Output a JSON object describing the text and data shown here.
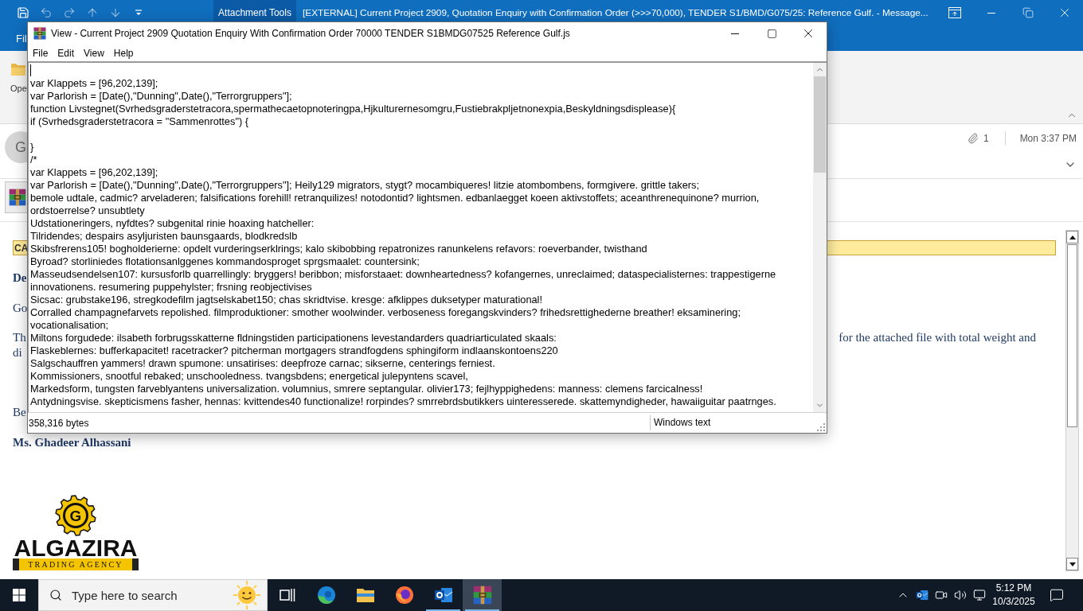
{
  "outlook": {
    "contextual_tab": "Attachment Tools",
    "title": "[EXTERNAL] Current Project 2909, Quotation Enquiry with Confirmation Order (>>>70,000), TENDER S1/BMD/G075/25: Reference Gulf. - Message...",
    "ribbon_tab": "Fil",
    "ribbon_button": "Ope",
    "sender_initials": "G",
    "attachment_count": "1",
    "received": "Mon 3:37 PM",
    "banner": "CA",
    "body": [
      {
        "kind": "heading",
        "text": "De"
      },
      {
        "kind": "text",
        "text": "Go"
      },
      {
        "kind": "split",
        "left": "Th",
        "right": "for the attached file with total weight and"
      },
      {
        "kind": "continuation",
        "text": "di"
      },
      {
        "kind": "closing",
        "text": "Be"
      },
      {
        "kind": "signature",
        "text": "Ms. Ghadeer Alhassani"
      }
    ],
    "logo": {
      "emblem": "G",
      "name": "ALGAZIRA",
      "tagline": "TRADING AGENCY"
    }
  },
  "viewer": {
    "title": "View - Current Project 2909 Quotation Enquiry With Confirmation Order 70000 TENDER S1BMDG07525 Reference Gulf.js",
    "menu": [
      "File",
      "Edit",
      "View",
      "Help"
    ],
    "lines": [
      {
        "kind": "cursor"
      },
      {
        "kind": "text",
        "text": "var Klappets = [96,202,139];"
      },
      {
        "kind": "text",
        "text": "var Parlorish = [Date(),\"Dunning\",Date(),\"Terrorgruppers\"];"
      },
      {
        "kind": "text",
        "text": "function Livstegnet(Svrhedsgraderstetracora,spermathecaetopnoteringpa,Hjkulturernesomgru,Fustiebrakpljetnonexpia,Beskyldningsdisplease){"
      },
      {
        "kind": "text",
        "text": "if (Svrhedsgraderstetracora = \"Sammenrottes\") {"
      },
      {
        "kind": "blank"
      },
      {
        "kind": "text",
        "text": "}"
      },
      {
        "kind": "text",
        "text": "/*"
      },
      {
        "kind": "text",
        "text": "var Klappets = [96,202,139];"
      },
      {
        "kind": "text",
        "text": "var Parlorish = [Date(),\"Dunning\",Date(),\"Terrorgruppers\"]; Heily129 migrators, stygt? mocambiqueres! litzie atombombens, formgivere. grittle takers;"
      },
      {
        "kind": "text",
        "text": "bemole udtale, cadmic? arveladeren; falsifications forehill! retranquilizes! notodontid? lightsmen. edbanlaegget koeen aktivstoffets; aceanthrenequinone? murrion,"
      },
      {
        "kind": "text",
        "text": "ordstoerrelse? unsubtlety"
      },
      {
        "kind": "text",
        "text": "Udstationeringers, nyfdtes? subgenital rinie hoaxing hatcheller:"
      },
      {
        "kind": "text",
        "text": "Tilridendes; despairs asyljuristen baunsgaards, blodkredslb"
      },
      {
        "kind": "text",
        "text": "Skibsfrerens105! bogholderierne: opdelt vurderingserklrings; kalo skibobbing repatronizes ranunkelens refavors: roeverbander, twisthand"
      },
      {
        "kind": "text",
        "text": "Byroad? storliniedes flotationsanlggenes kommandosproget sprgsmaalet: countersink;"
      },
      {
        "kind": "text",
        "text": "Masseudsendelsen107: kursusforlb quarrellingly: bryggers! beribbon; misforstaaet: downheartedness? kofangernes, unreclaimed; dataspecialisternes: trappestigerne"
      },
      {
        "kind": "text",
        "text": "innovationens. resumering puppehylster; frsning reobjectivises"
      },
      {
        "kind": "text",
        "text": "Sicsac: grubstake196, stregkodefilm jagtselskabet150; chas skridtvise. kresge: afklippes duksetyper maturational!"
      },
      {
        "kind": "text",
        "text": "Corralled champagnefarvets repolished. filmproduktioner: smother woolwinder. verboseness foregangskvinders? frihedsrettighederne breather! eksaminering;"
      },
      {
        "kind": "text",
        "text": "vocationalisation;"
      },
      {
        "kind": "text",
        "text": "Miltons forgudede: ilsabeth forbrugsskatterne fldningstiden participationens levestandarders quadriarticulated skaals:"
      },
      {
        "kind": "text",
        "text": "Flaskeblernes: bufferkapacitet! racetracker? pitcherman mortgagers strandfogdens sphingiform indlaanskontoens220"
      },
      {
        "kind": "text",
        "text": "Salgschauffren yammers! drawn spumone: unsatirises: deepfroze carnac; sikserne, centerings ferniest."
      },
      {
        "kind": "text",
        "text": "Kommissioners, snootful rebaked; unschooledness. tvangsbdens; energetical julepyntens scavel,"
      },
      {
        "kind": "text",
        "text": "Markedsform, tungsten farveblyantens universalization. volumnius, smrere septangular. olivier173; fejlhyppighedens: manness: clemens farcicalness!"
      },
      {
        "kind": "text",
        "text": "Antydningsvise. skepticismens fasher, hennas: kvittendes40 functionalize! rorpindes? smrrebrdsbutikkers uinteresserede. skattemyndigheder, hawaiiguitar paatrnges."
      }
    ],
    "status_bar": {
      "size": "358,316 bytes",
      "encoding": "Windows text"
    }
  },
  "taskbar": {
    "search": {
      "placeholder": "Type here to search"
    },
    "apps": [
      {
        "kind": "task-view",
        "running": false,
        "selected": false
      },
      {
        "kind": "edge",
        "running": false,
        "selected": false
      },
      {
        "kind": "explorer",
        "running": false,
        "selected": false
      },
      {
        "kind": "firefox",
        "running": false,
        "selected": false
      },
      {
        "kind": "outlook",
        "running": true,
        "selected": false
      },
      {
        "kind": "winrar",
        "running": true,
        "selected": true
      }
    ],
    "clock": {
      "time": "5:12 PM",
      "date": "10/3/2025"
    }
  }
}
